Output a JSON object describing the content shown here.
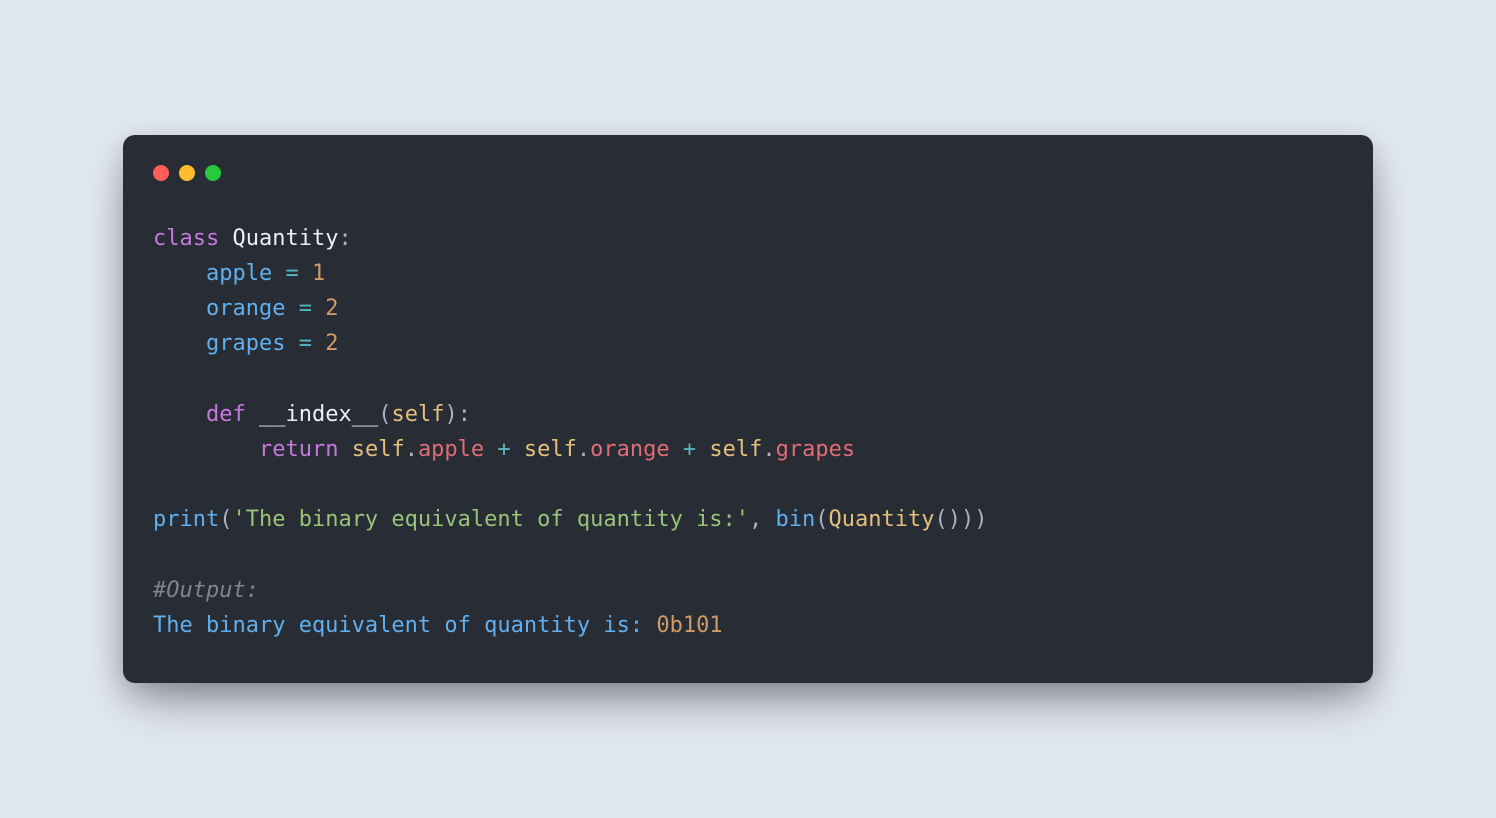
{
  "code": {
    "line1": {
      "kw": "class",
      "name": "Quantity",
      "colon": ":"
    },
    "line2": {
      "var": "apple",
      "eq": "=",
      "val": "1"
    },
    "line3": {
      "var": "orange",
      "eq": "=",
      "val": "2"
    },
    "line4": {
      "var": "grapes",
      "eq": "=",
      "val": "2"
    },
    "line6": {
      "kw": "def",
      "name": "__index__",
      "lparen": "(",
      "param": "self",
      "rparen": ")",
      "colon": ":"
    },
    "line7": {
      "kw": "return",
      "self1": "self",
      "dot1": ".",
      "attr1": "apple",
      "plus1": "+",
      "self2": "self",
      "dot2": ".",
      "attr2": "orange",
      "plus2": "+",
      "self3": "self",
      "dot3": ".",
      "attr3": "grapes"
    },
    "line9": {
      "fn": "print",
      "lp1": "(",
      "str": "'The binary equivalent of quantity is:'",
      "comma": ",",
      "bin": "bin",
      "lp2": "(",
      "cls": "Quantity",
      "lp3": "(",
      "rp3": ")",
      "rp2": ")",
      "rp1": ")"
    },
    "line11": {
      "comment": "#Output:"
    },
    "line12": {
      "text": "The binary equivalent of quantity is:",
      "val": "0b101"
    }
  }
}
